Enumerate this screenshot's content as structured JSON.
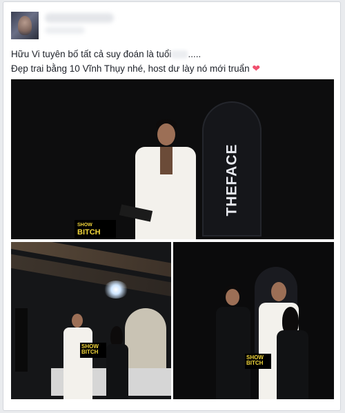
{
  "post": {
    "text_line1": "Hữu Vi tuyên bố tất cả suy đoán là tuổi",
    "text_line1_suffix": ".....",
    "text_line2": "Đẹp trai bằng 10 Vĩnh Thụy nhé, host dư lày nó mới truẩn",
    "heart_glyph": "❤",
    "photo1": {
      "board_text": "THEFACE",
      "logo_top": "SHOW",
      "logo_main": "BITCH"
    },
    "photo2": {
      "logo_top": "SHOW",
      "logo_main": "BITCH"
    },
    "photo3": {
      "logo_top": "SHOW",
      "logo_main": "BITCH"
    }
  },
  "colors": {
    "page_bg": "#e9ebee",
    "card_bg": "#ffffff",
    "text": "#1d2129",
    "heart": "#f0506e",
    "logo_yellow": "#f1d53a"
  }
}
